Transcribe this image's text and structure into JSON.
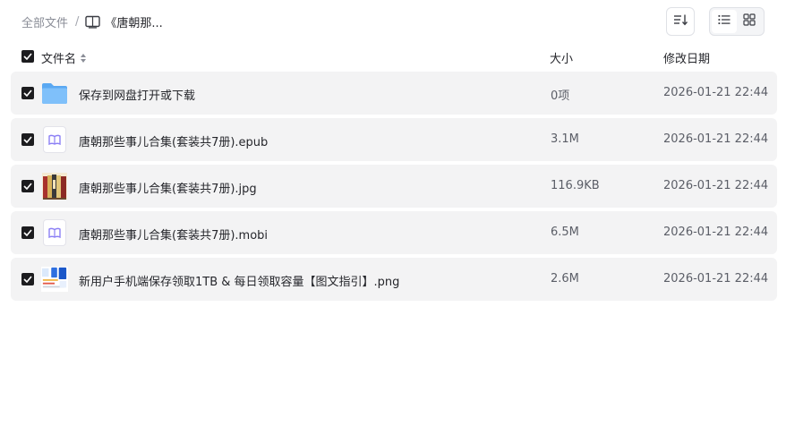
{
  "breadcrumb": {
    "root": "全部文件",
    "separator": "/",
    "current": "《唐朝那..."
  },
  "columns": {
    "name": "文件名",
    "size": "大小",
    "modified": "修改日期"
  },
  "files": [
    {
      "icon": "folder-icon",
      "name": "保存到网盘打开或下载",
      "size": "0项",
      "date": "2026-01-21 22:44",
      "checked": true
    },
    {
      "icon": "ebook-icon",
      "name": "唐朝那些事儿合集(套装共7册).epub",
      "size": "3.1M",
      "date": "2026-01-21 22:44",
      "checked": true
    },
    {
      "icon": "image-thumbnail",
      "name": "唐朝那些事儿合集(套装共7册).jpg",
      "size": "116.9KB",
      "date": "2026-01-21 22:44",
      "checked": true
    },
    {
      "icon": "ebook-icon",
      "name": "唐朝那些事儿合集(套装共7册).mobi",
      "size": "6.5M",
      "date": "2026-01-21 22:44",
      "checked": true
    },
    {
      "icon": "image-thumbnail",
      "name": "新用户手机端保存领取1TB & 每日领取容量【图文指引】.png",
      "size": "2.6M",
      "date": "2026-01-21 22:44",
      "checked": true
    }
  ],
  "colors": {
    "row_bg": "#f3f3f4",
    "ebook_accent": "#8b7ff5",
    "folder": "#6cb4f6",
    "checkbox": "#1c1c1f"
  }
}
